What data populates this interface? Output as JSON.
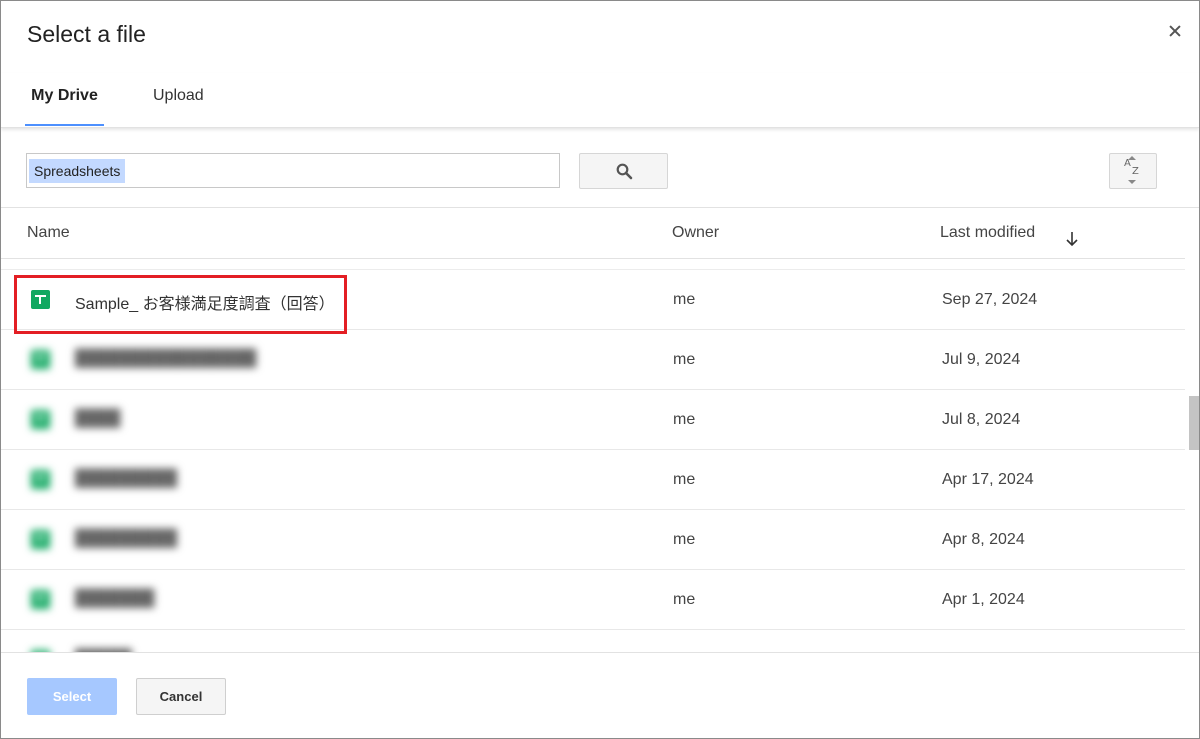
{
  "dialog": {
    "title": "Select a file"
  },
  "tabs": [
    {
      "label": "My Drive",
      "active": true
    },
    {
      "label": "Upload",
      "active": false
    }
  ],
  "search": {
    "chip": "Spreadsheets"
  },
  "columns": {
    "name": "Name",
    "owner": "Owner",
    "last_modified": "Last modified"
  },
  "files": [
    {
      "name": "Sample_ お客様満足度調査（回答）",
      "owner": "me",
      "date": "Sep 27, 2024",
      "highlighted": true
    },
    {
      "name": "",
      "owner": "me",
      "date": "Jul 9, 2024"
    },
    {
      "name": "",
      "owner": "me",
      "date": "Jul 8, 2024"
    },
    {
      "name": "",
      "owner": "me",
      "date": "Apr 17, 2024"
    },
    {
      "name": "",
      "owner": "me",
      "date": "Apr 8, 2024"
    },
    {
      "name": "",
      "owner": "me",
      "date": "Apr 1, 2024"
    },
    {
      "name": "",
      "owner": "",
      "date": ""
    }
  ],
  "footer": {
    "select_label": "Select",
    "cancel_label": "Cancel"
  },
  "colors": {
    "accent": "#4d90fe",
    "select_disabled": "#a6c8ff",
    "sheets_green": "#11a861",
    "highlight": "#e31e24"
  },
  "icons": [
    "close-icon",
    "search-icon",
    "sort-az-icon",
    "sort-arrow-down-icon",
    "spreadsheet-icon"
  ]
}
